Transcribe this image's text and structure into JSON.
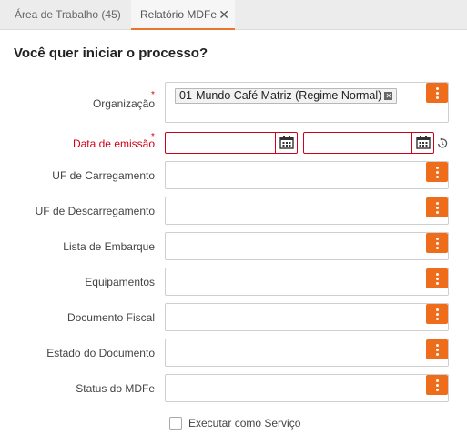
{
  "tabs": [
    {
      "label": "Área de Trabalho (45)"
    },
    {
      "label": "Relatório MDFe",
      "close": "✕"
    }
  ],
  "page_title": "Você quer iniciar o processo?",
  "colors": {
    "accent": "#ef6c1a",
    "required": "#d0021b"
  },
  "form": {
    "organizacao": {
      "label": "Organização",
      "required_mark": "*",
      "tag": "01-Mundo Café Matriz (Regime Normal)",
      "tag_remove": "✕"
    },
    "data_emissao": {
      "label": "Data de emissão",
      "required_mark": "*",
      "from": "",
      "to": ""
    },
    "uf_carregamento": {
      "label": "UF de Carregamento",
      "value": ""
    },
    "uf_descarregamento": {
      "label": "UF de Descarregamento",
      "value": ""
    },
    "lista_embarque": {
      "label": "Lista de Embarque",
      "value": ""
    },
    "equipamentos": {
      "label": "Equipamentos",
      "value": ""
    },
    "documento_fiscal": {
      "label": "Documento Fiscal",
      "value": ""
    },
    "estado_documento": {
      "label": "Estado do Documento",
      "value": ""
    },
    "status_mdfe": {
      "label": "Status do MDFe",
      "value": ""
    },
    "executar_servico": {
      "label": "Executar como Serviço",
      "checked": false
    }
  }
}
